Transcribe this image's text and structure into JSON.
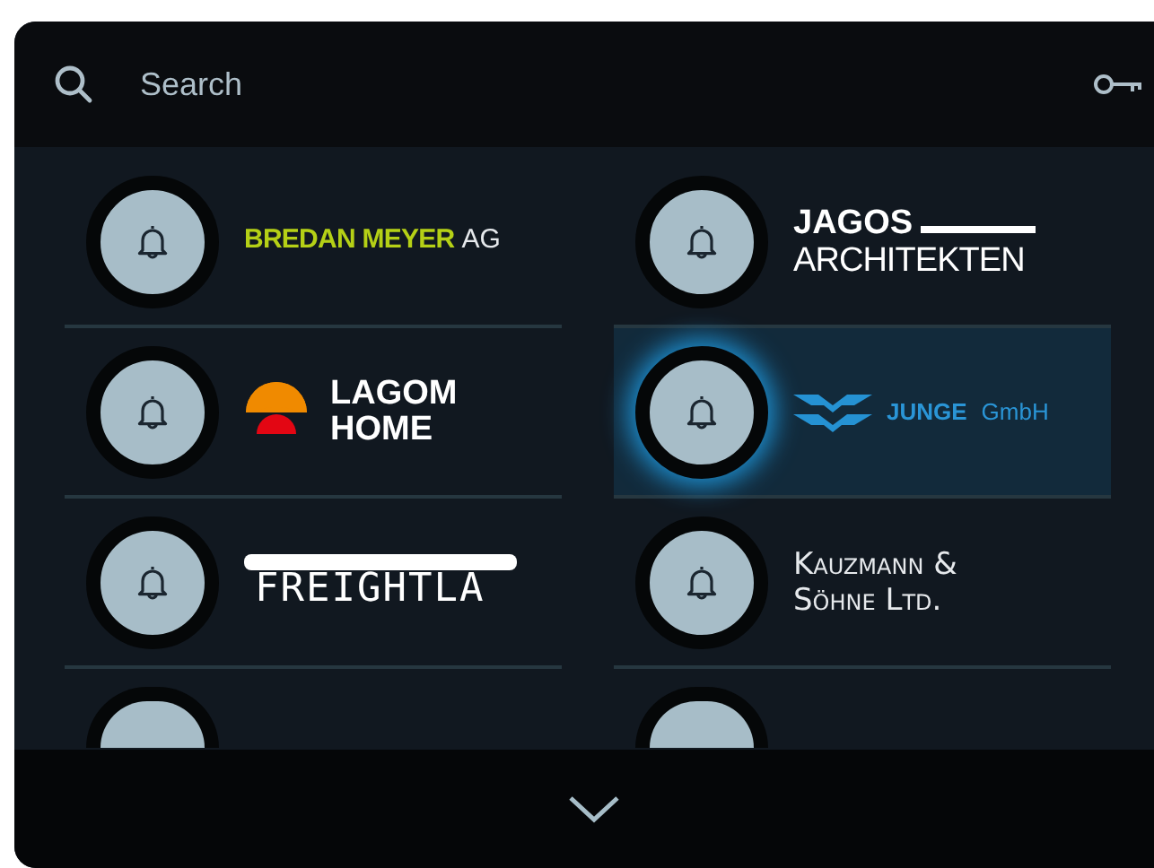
{
  "search": {
    "placeholder": "Search"
  },
  "contacts": [
    {
      "selected": false,
      "logo": {
        "kind": "split",
        "lines": [
          "BREDAN MEYER",
          "AG"
        ]
      }
    },
    {
      "selected": false,
      "logo": {
        "kind": "bar",
        "lines": [
          "JAGOS",
          "ARCHITEKTEN"
        ]
      }
    },
    {
      "selected": false,
      "logo": {
        "kind": "sun",
        "lines": [
          "LAGOM",
          "HOME"
        ]
      }
    },
    {
      "selected": true,
      "logo": {
        "kind": "wave",
        "lines": [
          "JUNGE",
          "GmbH"
        ]
      }
    },
    {
      "selected": false,
      "logo": {
        "kind": "stencil",
        "lines": [
          "FREIGHTLA"
        ]
      }
    },
    {
      "selected": false,
      "logo": {
        "kind": "smallcaps",
        "lines": [
          "Kauzmann &",
          "Söhne Ltd."
        ]
      }
    },
    {
      "selected": false
    },
    {
      "selected": false
    }
  ]
}
